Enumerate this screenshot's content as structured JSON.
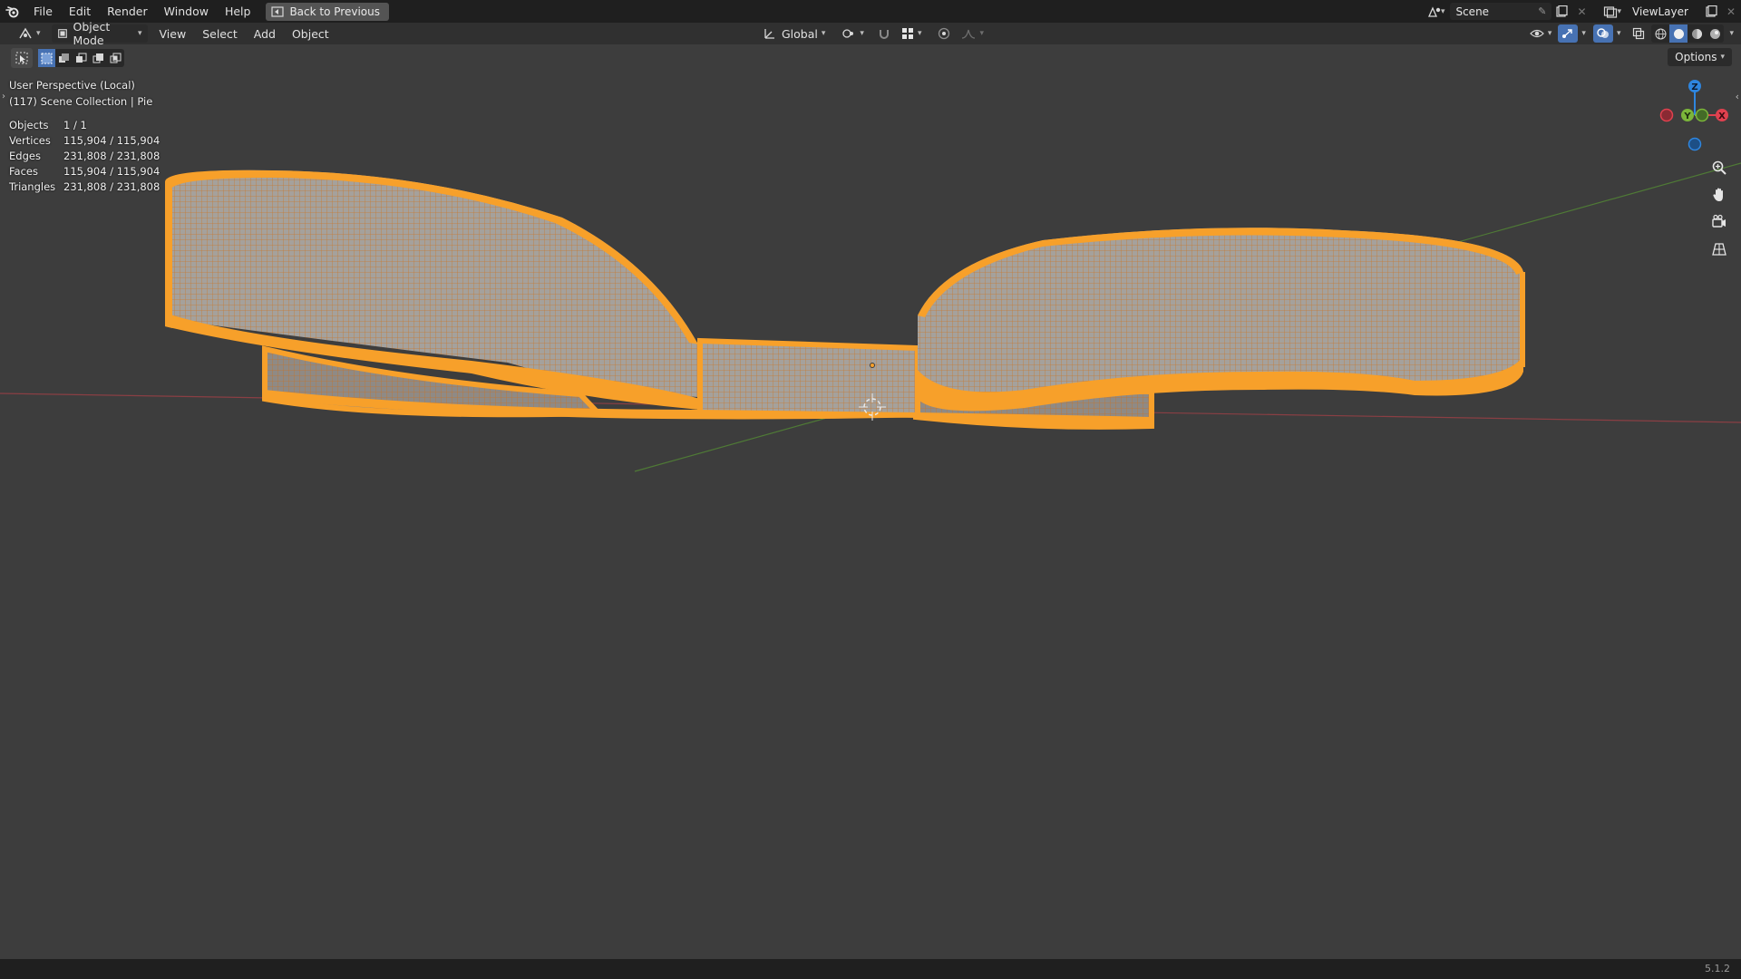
{
  "topbar": {
    "menus": [
      "File",
      "Edit",
      "Render",
      "Window",
      "Help"
    ],
    "back_label": "Back to Previous",
    "scene_value": "Scene",
    "view_layer_value": "ViewLayer"
  },
  "viewport_header": {
    "mode": "Object Mode",
    "menus": [
      "View",
      "Select",
      "Add",
      "Object"
    ],
    "orientation": "Global"
  },
  "options_label": "Options",
  "overlay": {
    "view_name": "User Perspective (Local)",
    "collection": "(117) Scene Collection | Pie",
    "stats": [
      {
        "key": "Objects",
        "value": "1 / 1"
      },
      {
        "key": "Vertices",
        "value": "115,904 / 115,904"
      },
      {
        "key": "Edges",
        "value": "231,808 / 231,808"
      },
      {
        "key": "Faces",
        "value": "115,904 / 115,904"
      },
      {
        "key": "Triangles",
        "value": "231,808 / 231,808"
      }
    ]
  },
  "gizmo": {
    "z_label": "Z",
    "y_label": "Y",
    "x_label": "X"
  },
  "version": "5.1.2",
  "colors": {
    "selection_orange": "#f7a02a",
    "x_axis": "#e0414f",
    "y_axis": "#7bb63a",
    "z_axis": "#2e86e0"
  }
}
